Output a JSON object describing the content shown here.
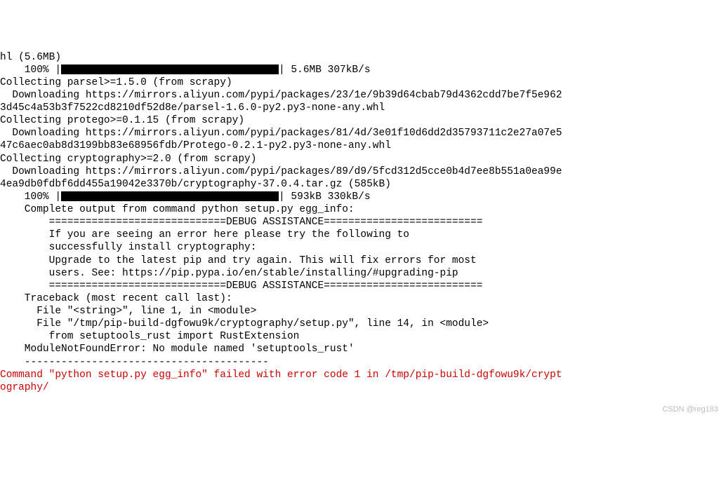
{
  "lines": {
    "l01": "hl (5.6MB)",
    "l02a": "    100% |",
    "l02b": "| 5.6MB 307kB/s",
    "l03": "Collecting parsel>=1.5.0 (from scrapy)",
    "l04": "  Downloading https://mirrors.aliyun.com/pypi/packages/23/1e/9b39d64cbab79d4362cdd7be7f5e962",
    "l05": "3d45c4a53b3f7522cd8210df52d8e/parsel-1.6.0-py2.py3-none-any.whl",
    "l06": "Collecting protego>=0.1.15 (from scrapy)",
    "l07": "  Downloading https://mirrors.aliyun.com/pypi/packages/81/4d/3e01f10d6dd2d35793711c2e27a07e5",
    "l08": "47c6aec0ab8d3199bb83e68956fdb/Protego-0.2.1-py2.py3-none-any.whl",
    "l09": "Collecting cryptography>=2.0 (from scrapy)",
    "l10": "  Downloading https://mirrors.aliyun.com/pypi/packages/89/d9/5fcd312d5cce0b4d7ee8b551a0ea99e",
    "l11": "4ea9db0fdbf6dd455a19042e3370b/cryptography-37.0.4.tar.gz (585kB)",
    "l12a": "    100% |",
    "l12b": "| 593kB 330kB/s",
    "l13": "    Complete output from command python setup.py egg_info:",
    "l14": "",
    "l15": "        =============================DEBUG ASSISTANCE==========================",
    "l16": "        If you are seeing an error here please try the following to",
    "l17": "        successfully install cryptography:",
    "l18": "",
    "l19": "        Upgrade to the latest pip and try again. This will fix errors for most",
    "l20": "        users. See: https://pip.pypa.io/en/stable/installing/#upgrading-pip",
    "l21": "        =============================DEBUG ASSISTANCE==========================",
    "l22": "",
    "l23": "    Traceback (most recent call last):",
    "l24": "      File \"<string>\", line 1, in <module>",
    "l25": "      File \"/tmp/pip-build-dgfowu9k/cryptography/setup.py\", line 14, in <module>",
    "l26": "        from setuptools_rust import RustExtension",
    "l27": "    ModuleNotFoundError: No module named 'setuptools_rust'",
    "l28": "",
    "l29": "    ----------------------------------------",
    "l30": "Command \"python setup.py egg_info\" failed with error code 1 in /tmp/pip-build-dgfowu9k/crypt",
    "l31": "ography/"
  },
  "watermark": "CSDN @reg183"
}
